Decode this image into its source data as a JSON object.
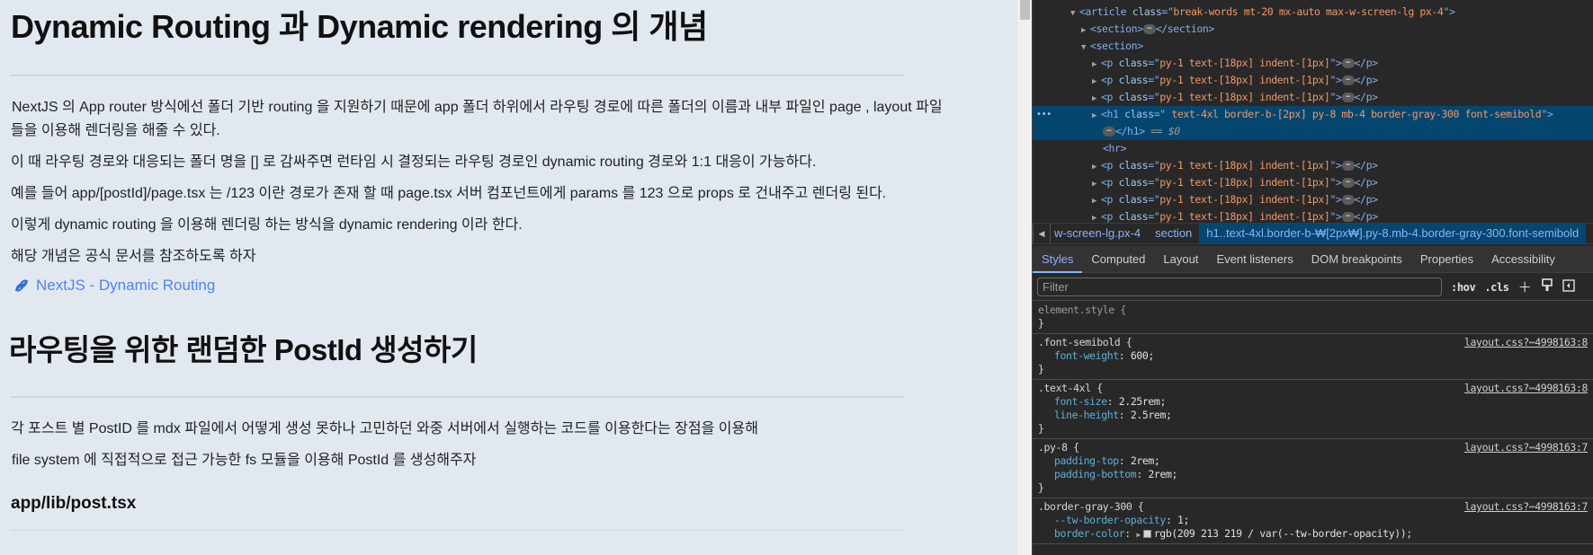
{
  "page": {
    "heading1": "Dynamic Routing 과 Dynamic rendering 의 개념",
    "paragraphs1": [
      "NextJS 의 App router 방식에선 폴더 기반 routing 을 지원하기 때문에 app 폴더 하위에서 라우팅 경로에 따른 폴더의 이름과 내부 파일인 page , layout 파일",
      "들을 이용해 렌더링을 해줄 수 있다.",
      "이 때 라우팅 경로와 대응되는 폴더 명을 [] 로 감싸주면 런타임 시 결정되는 라우팅 경로인 dynamic routing 경로와 1:1 대응이 가능하다.",
      "예를 들어 app/[postId]/page.tsx 는 /123 이란 경로가 존재 할 때 page.tsx 서버 컴포넌트에게 params 를 123 으로 props 로 건내주고 렌더링 된다.",
      "이렇게 dynamic routing 을 이용해 렌더링 하는 방식을 dynamic rendering 이라 한다.",
      "해당 개념은 공식 문서를 참조하도록 하자"
    ],
    "link": {
      "icon": "link-icon",
      "label": "NextJS - Dynamic Routing",
      "color": "#4f86e8"
    },
    "heading2": "라우팅을 위한 랜덤한 PostId 생성하기",
    "paragraphs2": [
      "각 포스트 별 PostID 를 mdx 파일에서 어떻게 생성 못하나 고민하던 와중 서버에서 실행하는 코드를 이용한다는 장점을 이용해",
      "file system 에 직접적으로 접근 가능한 fs 모듈을 이용해 PostId 를 생성해주자"
    ],
    "heading3": "app/lib/post.tsx"
  },
  "devtools": {
    "dom": {
      "article_open": {
        "tag": "article",
        "attr": "class",
        "value": "break-words mt-20 mx-auto max-w-screen-lg px-4"
      },
      "section_collapsed": {
        "open": "<section>",
        "close": "</section>"
      },
      "section_open": "<section>",
      "p_attr_value": "py-1 text-[18px] indent-[1px]",
      "h1_attr_value": " text-4xl border-b-[2px]  py-8 mb-4 border-gray-300 font-semibold",
      "h1_close": "</h1>",
      "selected_marker": "== $0",
      "hr": "<hr>",
      "ellipsis": "⋯"
    },
    "breadcrumb": [
      {
        "label": "w-screen-lg.px-4",
        "active": false
      },
      {
        "label": "section",
        "active": false
      },
      {
        "label": "h1..text-4xl.border-b-₩[2px₩].py-8.mb-4.border-gray-300.font-semibold",
        "active": true
      }
    ],
    "tabs": [
      "Styles",
      "Computed",
      "Layout",
      "Event listeners",
      "DOM breakpoints",
      "Properties",
      "Accessibility"
    ],
    "active_tab": "Styles",
    "filter": {
      "placeholder": "Filter",
      "value": ""
    },
    "filter_buttons": {
      "hov": ":hov",
      "cls": ".cls"
    },
    "rules": [
      {
        "selector": "element.style {",
        "props": [],
        "source": ""
      },
      {
        "selector": ".font-semibold {",
        "props": [
          {
            "name": "font-weight",
            "value": "600;"
          }
        ],
        "source": "layout.css?⋯4998163:8"
      },
      {
        "selector": ".text-4xl {",
        "props": [
          {
            "name": "font-size",
            "value": "2.25rem;"
          },
          {
            "name": "line-height",
            "value": "2.5rem;"
          }
        ],
        "source": "layout.css?⋯4998163:8"
      },
      {
        "selector": ".py-8 {",
        "props": [
          {
            "name": "padding-top",
            "value": "2rem;"
          },
          {
            "name": "padding-bottom",
            "value": "2rem;"
          }
        ],
        "source": "layout.css?⋯4998163:7"
      },
      {
        "selector": ".border-gray-300 {",
        "props": [
          {
            "name": "--tw-border-opacity",
            "value": "1;"
          },
          {
            "name": "border-color",
            "value": "rgb(209 213 219 / var(--tw-border-opacity));"
          }
        ],
        "source": "layout.css?⋯4998163:7"
      }
    ]
  }
}
